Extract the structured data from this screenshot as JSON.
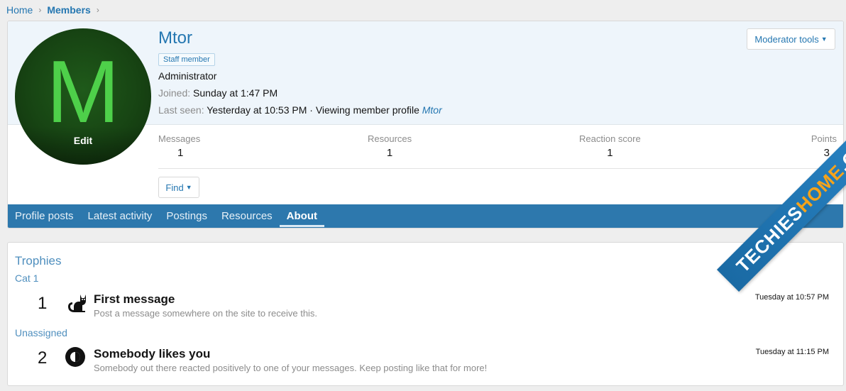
{
  "breadcrumb": {
    "home": "Home",
    "members": "Members",
    "separator": "›"
  },
  "profile": {
    "avatar_letter": "M",
    "avatar_edit": "Edit",
    "username": "Mtor",
    "badge": "Staff member",
    "title": "Administrator",
    "joined_label": "Joined:",
    "joined_value": "Sunday at 1:47 PM",
    "seen_label": "Last seen:",
    "seen_value": "Yesterday at 10:53 PM · Viewing member profile",
    "seen_link": "Mtor",
    "mod_tools": "Moderator tools",
    "find": "Find"
  },
  "stats": [
    {
      "label": "Messages",
      "value": "1"
    },
    {
      "label": "Resources",
      "value": "1"
    },
    {
      "label": "Reaction score",
      "value": "1"
    },
    {
      "label": "Points",
      "value": "3"
    }
  ],
  "tabs": [
    {
      "label": "Profile posts"
    },
    {
      "label": "Latest activity"
    },
    {
      "label": "Postings"
    },
    {
      "label": "Resources"
    },
    {
      "label": "About"
    }
  ],
  "trophies": {
    "title": "Trophies",
    "categories": [
      {
        "name": "Cat 1",
        "items": [
          {
            "points": "1",
            "icon": "cat-icon",
            "name": "First message",
            "description": "Post a message somewhere on the site to receive this.",
            "time": "Tuesday at 10:57 PM"
          }
        ]
      },
      {
        "name": "Unassigned",
        "items": [
          {
            "points": "2",
            "icon": "contrast-circle-icon",
            "name": "Somebody likes you",
            "description": "Somebody out there reacted positively to one of your messages. Keep posting like that for more!",
            "time": "Tuesday at 11:15 PM"
          }
        ]
      }
    ]
  },
  "watermark": {
    "part1": "TECHIES",
    "part2": "HOME",
    "part3": ".COM"
  },
  "colors": {
    "brand": "#2577b1",
    "tab_bar": "#2d78ad",
    "avatar_bg": "#174413",
    "avatar_letter": "#4ed04a"
  }
}
